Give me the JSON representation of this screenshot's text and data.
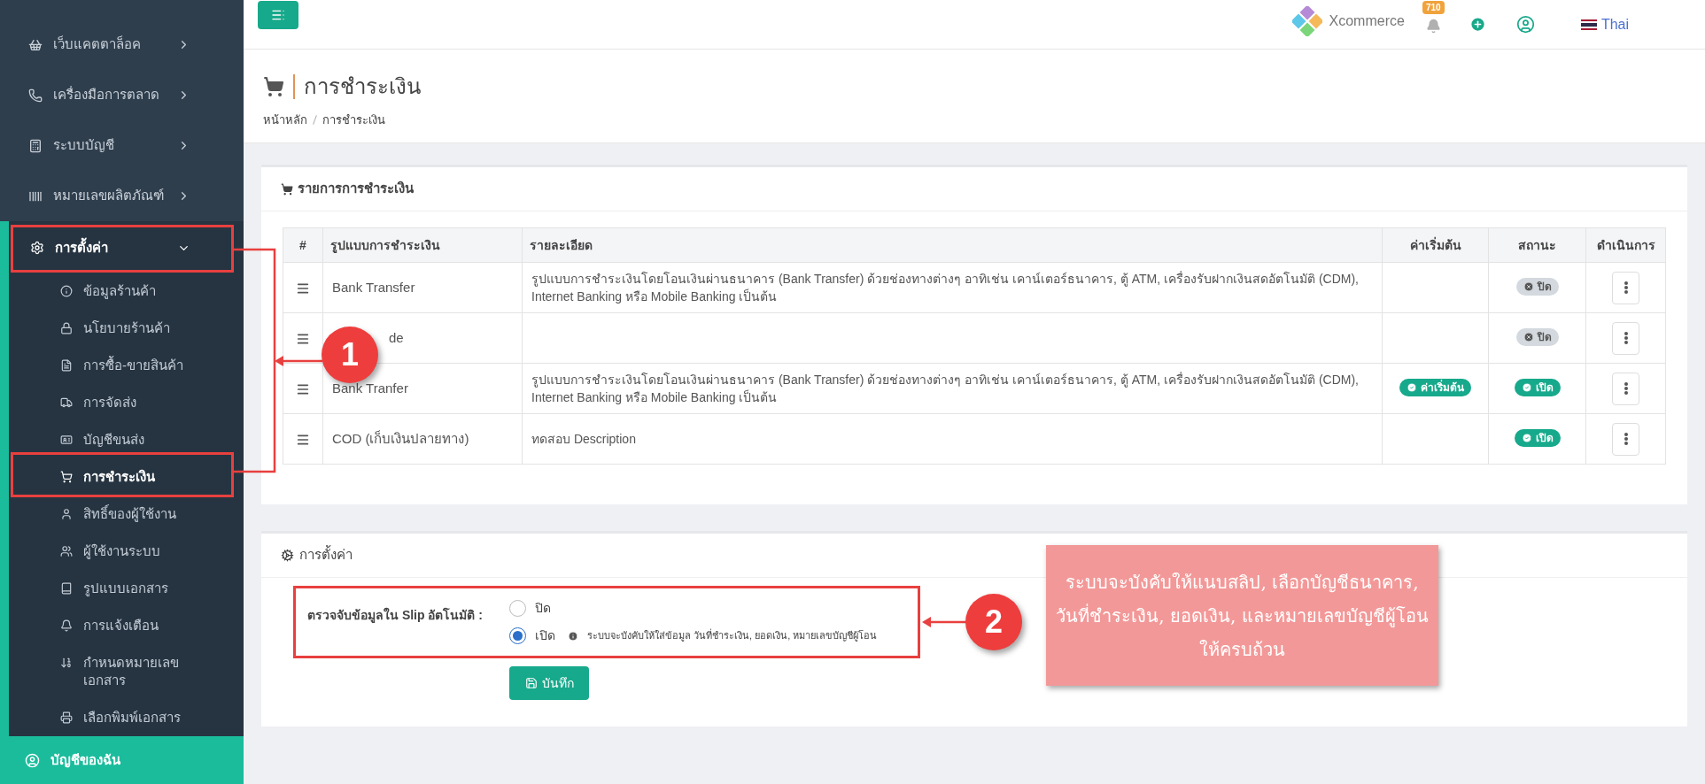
{
  "topbar": {
    "brand": "Xcommerce",
    "notification_count": "710",
    "language": "Thai"
  },
  "sidebar": {
    "items": [
      {
        "label": "เว็บแคตตาล็อค",
        "expanded": false
      },
      {
        "label": "เครื่องมือการตลาด",
        "expanded": false
      },
      {
        "label": "ระบบบัญชี",
        "expanded": false
      },
      {
        "label": "หมายเลขผลิตภัณฑ์",
        "expanded": false
      },
      {
        "label": "การตั้งค่า",
        "expanded": true,
        "children": [
          {
            "label": "ข้อมูลร้านค้า",
            "selected": false
          },
          {
            "label": "นโยบายร้านค้า",
            "selected": false
          },
          {
            "label": "การซื้อ-ขายสินค้า",
            "selected": false
          },
          {
            "label": "การจัดส่ง",
            "selected": false
          },
          {
            "label": "บัญชีขนส่ง",
            "selected": false
          },
          {
            "label": "การชำระเงิน",
            "selected": true
          },
          {
            "label": "สิทธิ์ของผู้ใช้งาน",
            "selected": false
          },
          {
            "label": "ผู้ใช้งานระบบ",
            "selected": false
          },
          {
            "label": "รูปแบบเอกสาร",
            "selected": false
          },
          {
            "label": "การแจ้งเตือน",
            "selected": false
          },
          {
            "label": "กำหนดหมายเลขเอกสาร",
            "selected": false
          },
          {
            "label": "เลือกพิมพ์เอกสาร",
            "selected": false
          }
        ]
      }
    ],
    "account": "บัญชีของฉัน"
  },
  "page": {
    "title": "การชำระเงิน",
    "breadcrumb": [
      "หน้าหลัก",
      "การชำระเงิน"
    ]
  },
  "payments_panel": {
    "title": "รายการการชำระเงิน",
    "columns": [
      "#",
      "รูปแบบการชำระเงิน",
      "รายละเอียด",
      "ค่าเริ่มต้น",
      "สถานะ",
      "ดำเนินการ"
    ],
    "rows": [
      {
        "name": "Bank Transfer",
        "detail": "รูปแบบการชำระเงินโดยโอนเงินผ่านธนาคาร (Bank Transfer) ด้วยช่องทางต่างๆ อาทิเช่น เคาน์เตอร์ธนาคาร, ตู้ ATM, เครื่องรับฝากเงินสดอัตโนมัติ (CDM), Internet Banking หรือ Mobile Banking เป็นต้น",
        "status": {
          "on": false,
          "label": "ปิด"
        }
      },
      {
        "name": "de",
        "status": {
          "on": false,
          "label": "ปิด"
        }
      },
      {
        "name": "Bank Tranfer",
        "detail": "รูปแบบการชำระเงินโดยโอนเงินผ่านธนาคาร (Bank Transfer) ด้วยช่องทางต่างๆ อาทิเช่น เคาน์เตอร์ธนาคาร, ตู้ ATM, เครื่องรับฝากเงินสดอัตโนมัติ (CDM), Internet Banking หรือ Mobile Banking เป็นต้น",
        "default_badge": "ค่าเริ่มต้น",
        "status": {
          "on": true,
          "label": "เปิด"
        }
      },
      {
        "name": "COD (เก็บเงินปลายทาง)",
        "detail": "ทดสอบ Description",
        "status": {
          "on": true,
          "label": "เปิด"
        }
      }
    ]
  },
  "settings_panel": {
    "title": "การตั้งค่า",
    "field_label": "ตรวจจับข้อมูลใน Slip อัตโนมัติ :",
    "options": [
      {
        "label": "ปิด",
        "selected": false
      },
      {
        "label": "เปิด",
        "selected": true,
        "hint": "ระบบจะบังคับให้ใส่ข้อมูล วันที่ชำระเงิน, ยอดเงิน, หมายเลขบัญชีผู้โอน"
      }
    ],
    "save_button": "บันทึก"
  },
  "annotations": {
    "callouts": [
      "1",
      "2"
    ],
    "note": "ระบบจะบังคับให้แนบสลิป, เลือกบัญชีธนาคาร, วันที่ชำระเงิน, ยอดเงิน, และหมายเลขบัญชีผู้โอน ให้ครบถ้วน"
  }
}
